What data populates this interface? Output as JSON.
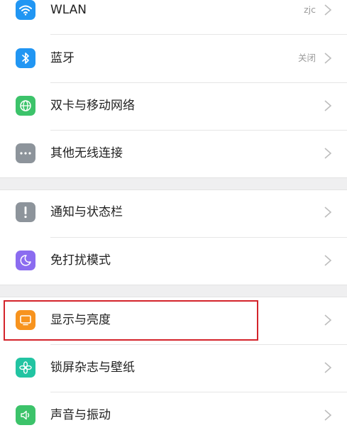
{
  "settings": {
    "items": [
      {
        "label": "WLAN",
        "value": "zjc",
        "icon": "wifi-icon",
        "color": "#2196F3"
      },
      {
        "label": "蓝牙",
        "value": "关闭",
        "icon": "bluetooth-icon",
        "color": "#2196F3"
      },
      {
        "label": "双卡与移动网络",
        "value": "",
        "icon": "globe-icon",
        "color": "#3CC36A"
      },
      {
        "label": "其他无线连接",
        "value": "",
        "icon": "more-dots-icon",
        "color": "#8D949B"
      },
      {
        "label": "通知与状态栏",
        "value": "",
        "icon": "exclamation-icon",
        "color": "#8D949B"
      },
      {
        "label": "免打扰模式",
        "value": "",
        "icon": "moon-icon",
        "color": "#8B6CF0"
      },
      {
        "label": "显示与亮度",
        "value": "",
        "icon": "display-icon",
        "color": "#F7931E"
      },
      {
        "label": "锁屏杂志与壁纸",
        "value": "",
        "icon": "flower-icon",
        "color": "#22C4A2"
      },
      {
        "label": "声音与振动",
        "value": "",
        "icon": "speaker-icon",
        "color": "#3CC36A"
      }
    ],
    "highlight_color": "#D4242B"
  }
}
